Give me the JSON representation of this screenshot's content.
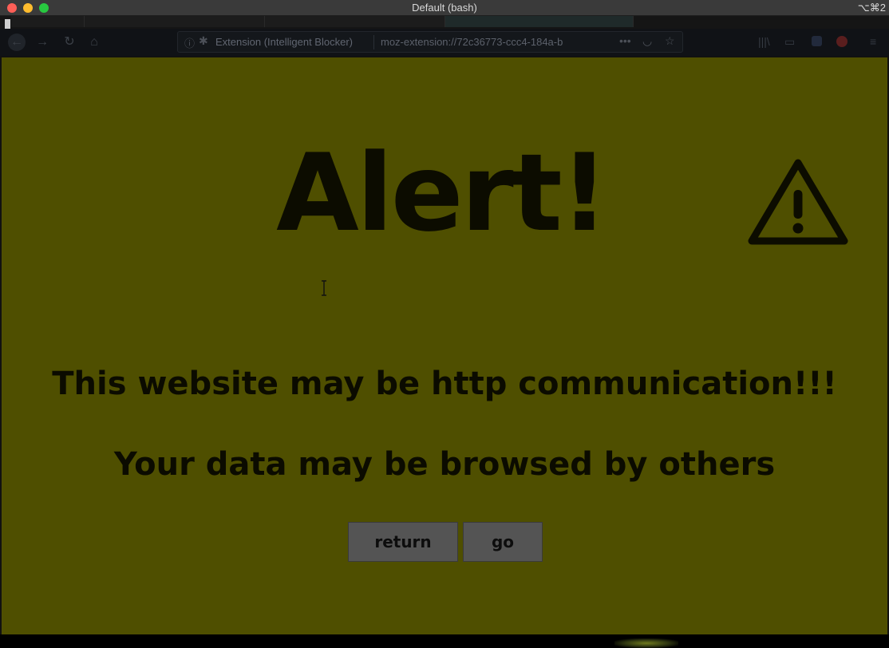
{
  "window": {
    "title": "Default (bash)",
    "shortcut": "⌥⌘2"
  },
  "browser": {
    "url_identity_label": "Extension (Intelligent Blocker)",
    "url": "moz-extension://72c36773-ccc4-184a-b",
    "icons": [
      "back-icon",
      "forward-icon",
      "reload-icon",
      "home-icon",
      "info-icon",
      "puzzle-icon",
      "more-icon",
      "pocket-icon",
      "star-icon",
      "library-icon",
      "sidebar-icon",
      "extension-icon",
      "extension-icon",
      "menu-icon"
    ]
  },
  "page": {
    "heading": "Alert!",
    "warning_icon": "warning-triangle-icon",
    "message1": "This website may be http communication!!!",
    "message2": "Your data may be browsed by others",
    "buttons": {
      "return": "return",
      "go": "go"
    },
    "background_color": "#4f4f00"
  }
}
